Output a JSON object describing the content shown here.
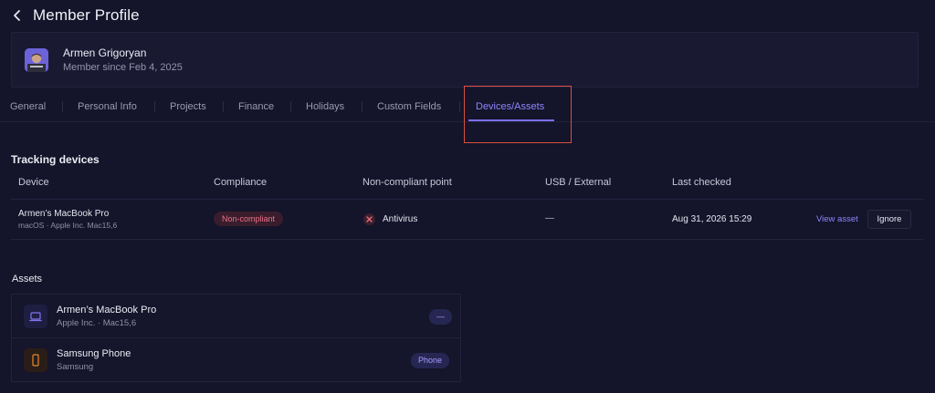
{
  "header": {
    "title": "Member Profile"
  },
  "profile": {
    "name": "Armen Grigoryan",
    "member_since": "Member since Feb 4, 2025"
  },
  "tabs": [
    {
      "label": "General"
    },
    {
      "label": "Personal Info"
    },
    {
      "label": "Projects"
    },
    {
      "label": "Finance"
    },
    {
      "label": "Holidays"
    },
    {
      "label": "Custom Fields"
    },
    {
      "label": "Devices/Assets",
      "active": true
    }
  ],
  "tracking": {
    "title": "Tracking devices",
    "columns": [
      "Device",
      "Compliance",
      "Non-compliant point",
      "USB / External",
      "Last checked"
    ],
    "rows": [
      {
        "device": "Armen’s MacBook Pro",
        "device_sub": "macOS · Apple Inc. Mac15,6",
        "compliance": "Non-compliant",
        "non_compliant_point": "Antivirus",
        "usb": "—",
        "last_checked": "Aug 31, 2026 15:29",
        "view_label": "View asset",
        "ignore_label": "Ignore"
      }
    ]
  },
  "assets": {
    "title": "Assets",
    "items": [
      {
        "name": "Armen’s MacBook Pro",
        "sub": "Apple Inc. · Mac15,6",
        "badge": "—",
        "icon": "laptop-icon"
      },
      {
        "name": "Samsung Phone",
        "sub": "Samsung",
        "badge": "Phone",
        "icon": "phone-icon"
      }
    ]
  },
  "colors": {
    "background": "#14142a",
    "accent": "#8f86ff",
    "danger": "#e9738a",
    "highlight": "#d9503f"
  }
}
